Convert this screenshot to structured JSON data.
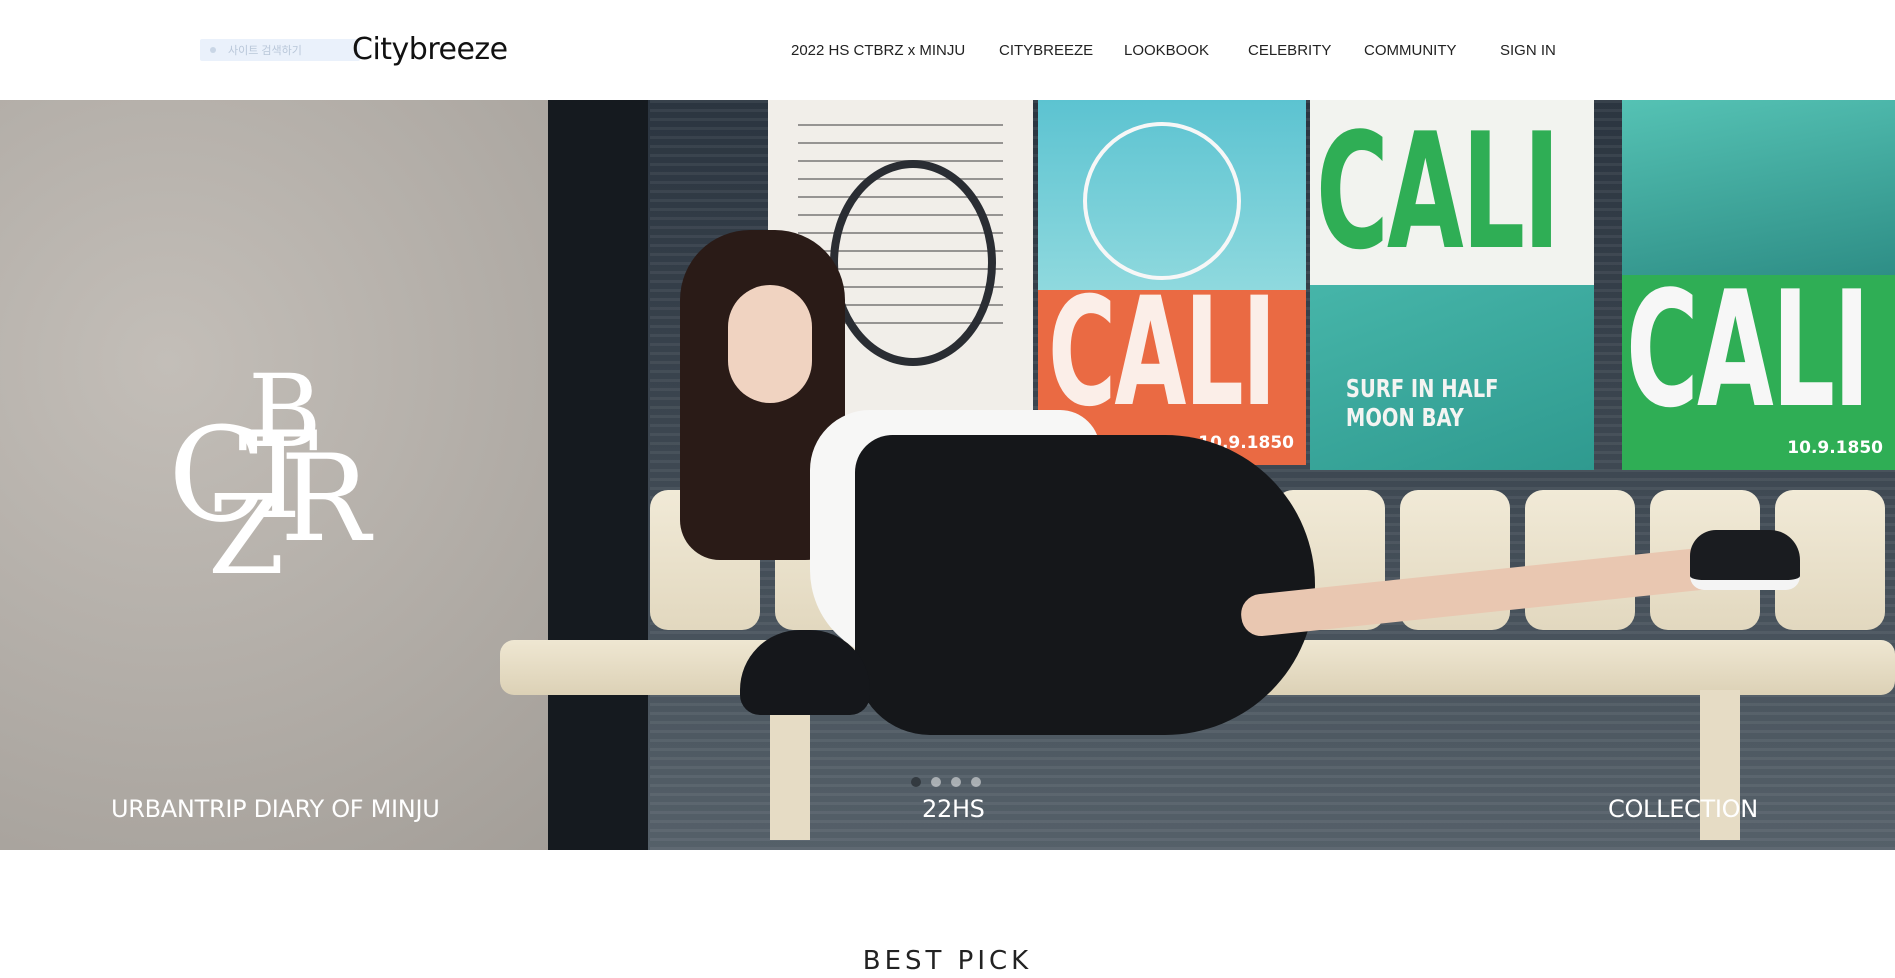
{
  "header": {
    "skip_link_label": "사이트 검색하기",
    "logo_text": "Citybreeze",
    "nav": [
      {
        "label": "2022 HS CTBRZ x MINJU"
      },
      {
        "label": "CITYBREEZE"
      },
      {
        "label": "LOOKBOOK"
      },
      {
        "label": "CELEBRITY"
      },
      {
        "label": "COMMUNITY"
      },
      {
        "label": "SIGN IN"
      }
    ]
  },
  "hero": {
    "brand_mark_letters": [
      "B",
      "C",
      "T",
      "R",
      "Z"
    ],
    "posters": {
      "orange_word": "CALI",
      "orange_date": "10.9.1850",
      "green_word": "CALI",
      "green_tagline": "SURF IN HALF MOON BAY",
      "sea_word": "CALI",
      "sea_date": "10.9.1850"
    },
    "slides": {
      "count": 4,
      "active_index": 1
    },
    "captions": {
      "left": "URBANTRIP DIARY OF MINJU",
      "center": "22HS",
      "right": "COLLECTION"
    }
  },
  "sections": {
    "best_pick_title": "BEST PICK"
  },
  "colors": {
    "accent_orange": "#ea6a43",
    "accent_green": "#2fae55",
    "sea_teal": "#46b5a9",
    "text_dark": "#222222"
  }
}
